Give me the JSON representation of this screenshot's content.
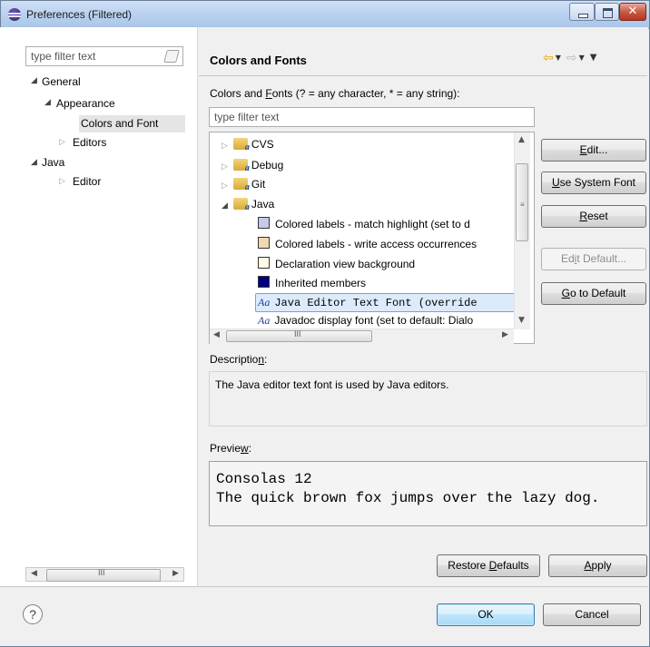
{
  "window": {
    "title": "Preferences (Filtered)"
  },
  "left": {
    "filter_placeholder": "type filter text",
    "tree": [
      {
        "label": "General"
      },
      {
        "label": "Appearance"
      },
      {
        "label": "Colors and Font"
      },
      {
        "label": "Editors"
      },
      {
        "label": "Java"
      },
      {
        "label": "Editor"
      }
    ],
    "scroll_grip": "III"
  },
  "page": {
    "title": "Colors and Fonts",
    "section_label_pre": "Colors and ",
    "section_label_ul": "F",
    "section_label_post": "onts (? = any character, * = any string):",
    "filter_placeholder": "type filter text",
    "tree": [
      {
        "label": "CVS",
        "kind": "folder",
        "expanded": false
      },
      {
        "label": "Debug",
        "kind": "folder",
        "expanded": false
      },
      {
        "label": "Git",
        "kind": "folder",
        "expanded": false
      },
      {
        "label": "Java",
        "kind": "folder",
        "expanded": true
      },
      {
        "label": "Colored labels - match highlight (set to d",
        "kind": "color",
        "color": "#c8c8e8"
      },
      {
        "label": "Colored labels - write access occurrences",
        "kind": "color",
        "color": "#f0d8b0"
      },
      {
        "label": "Declaration view background",
        "kind": "color",
        "color": "#fffbe6"
      },
      {
        "label": "Inherited members",
        "kind": "color",
        "color": "#000080"
      },
      {
        "label": "Java Editor Text Font (override",
        "kind": "font"
      },
      {
        "label": "Javadoc display font (set to default: Dialo",
        "kind": "font"
      }
    ],
    "font_icon": "Aa",
    "scroll_grip": "III",
    "buttons": {
      "edit_ul": "E",
      "edit_rest": "dit...",
      "use_system_ul": "U",
      "use_system_rest": "se System Font",
      "reset_ul": "R",
      "reset_rest": "eset",
      "edit_default_pre": "Ed",
      "edit_default_ul": "i",
      "edit_default_post": "t Default...",
      "go_default_ul": "G",
      "go_default_rest": "o to Default"
    },
    "description_label_pre": "Descriptio",
    "description_label_ul": "n",
    "description_label_post": ":",
    "description_text": "The Java editor text font is used by Java editors.",
    "preview_label_pre": "Previe",
    "preview_label_ul": "w",
    "preview_label_post": ":",
    "preview_lines": [
      "Consolas 12",
      "The quick brown fox jumps over the lazy dog."
    ],
    "restore_pre": "Restore ",
    "restore_ul": "D",
    "restore_post": "efaults",
    "apply_ul": "A",
    "apply_rest": "pply"
  },
  "footer": {
    "help": "?",
    "ok": "OK",
    "cancel": "Cancel"
  }
}
